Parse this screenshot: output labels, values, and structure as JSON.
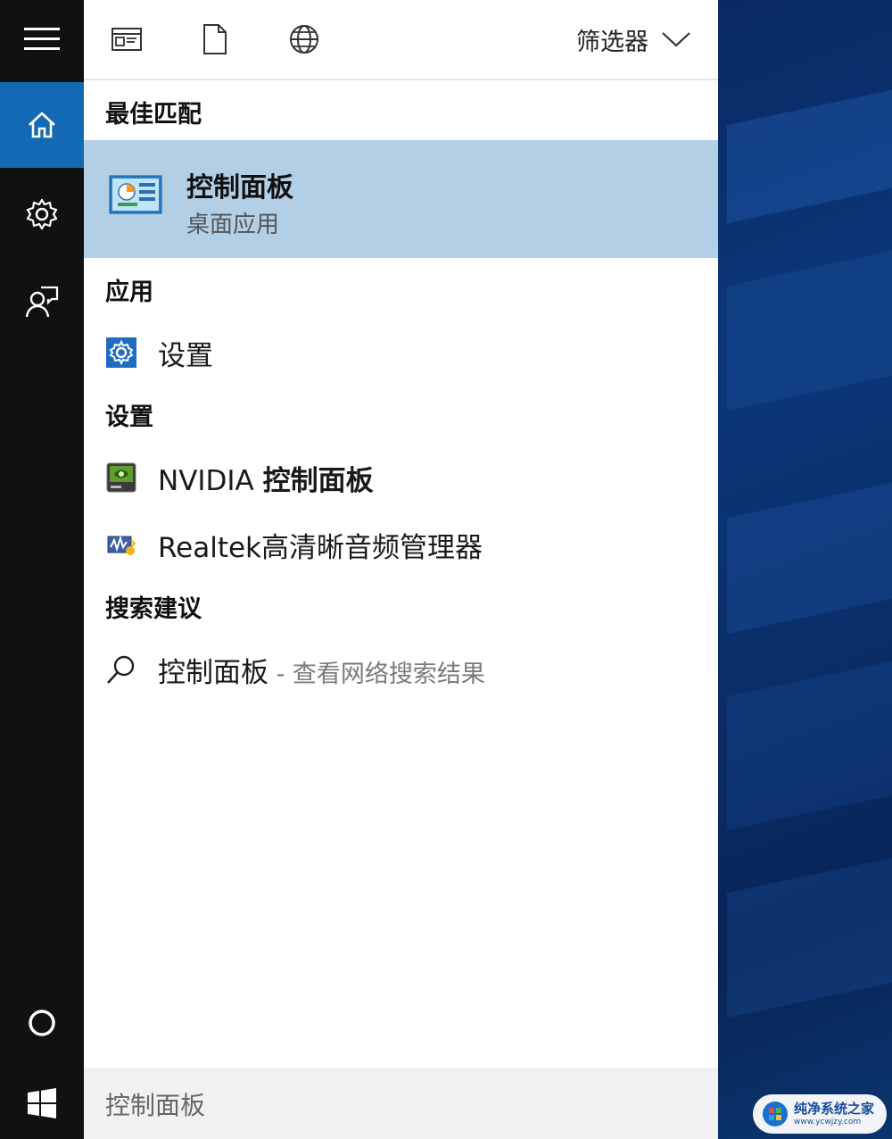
{
  "toolbar": {
    "filter_label": "筛选器"
  },
  "sections": {
    "best_match": "最佳匹配",
    "apps": "应用",
    "settings": "设置",
    "suggestions": "搜索建议"
  },
  "best_match": {
    "title": "控制面板",
    "subtitle": "桌面应用"
  },
  "apps": [
    {
      "label": "设置",
      "icon": "settings-gear-icon"
    }
  ],
  "settings_items": [
    {
      "prefix": "NVIDIA ",
      "bold": "控制面板",
      "icon": "nvidia-icon"
    },
    {
      "label": "Realtek高清晰音频管理器",
      "icon": "realtek-audio-icon"
    }
  ],
  "suggestion": {
    "query": "控制面板",
    "hint": " - 查看网络搜索结果"
  },
  "search": {
    "value": "控制面板"
  },
  "watermark": {
    "text": "纯净系统之家",
    "url": "www.ycwjzy.com"
  },
  "colors": {
    "accent": "#1469b4",
    "selected_bg": "#b3cfe6",
    "rail_bg": "#111111"
  }
}
